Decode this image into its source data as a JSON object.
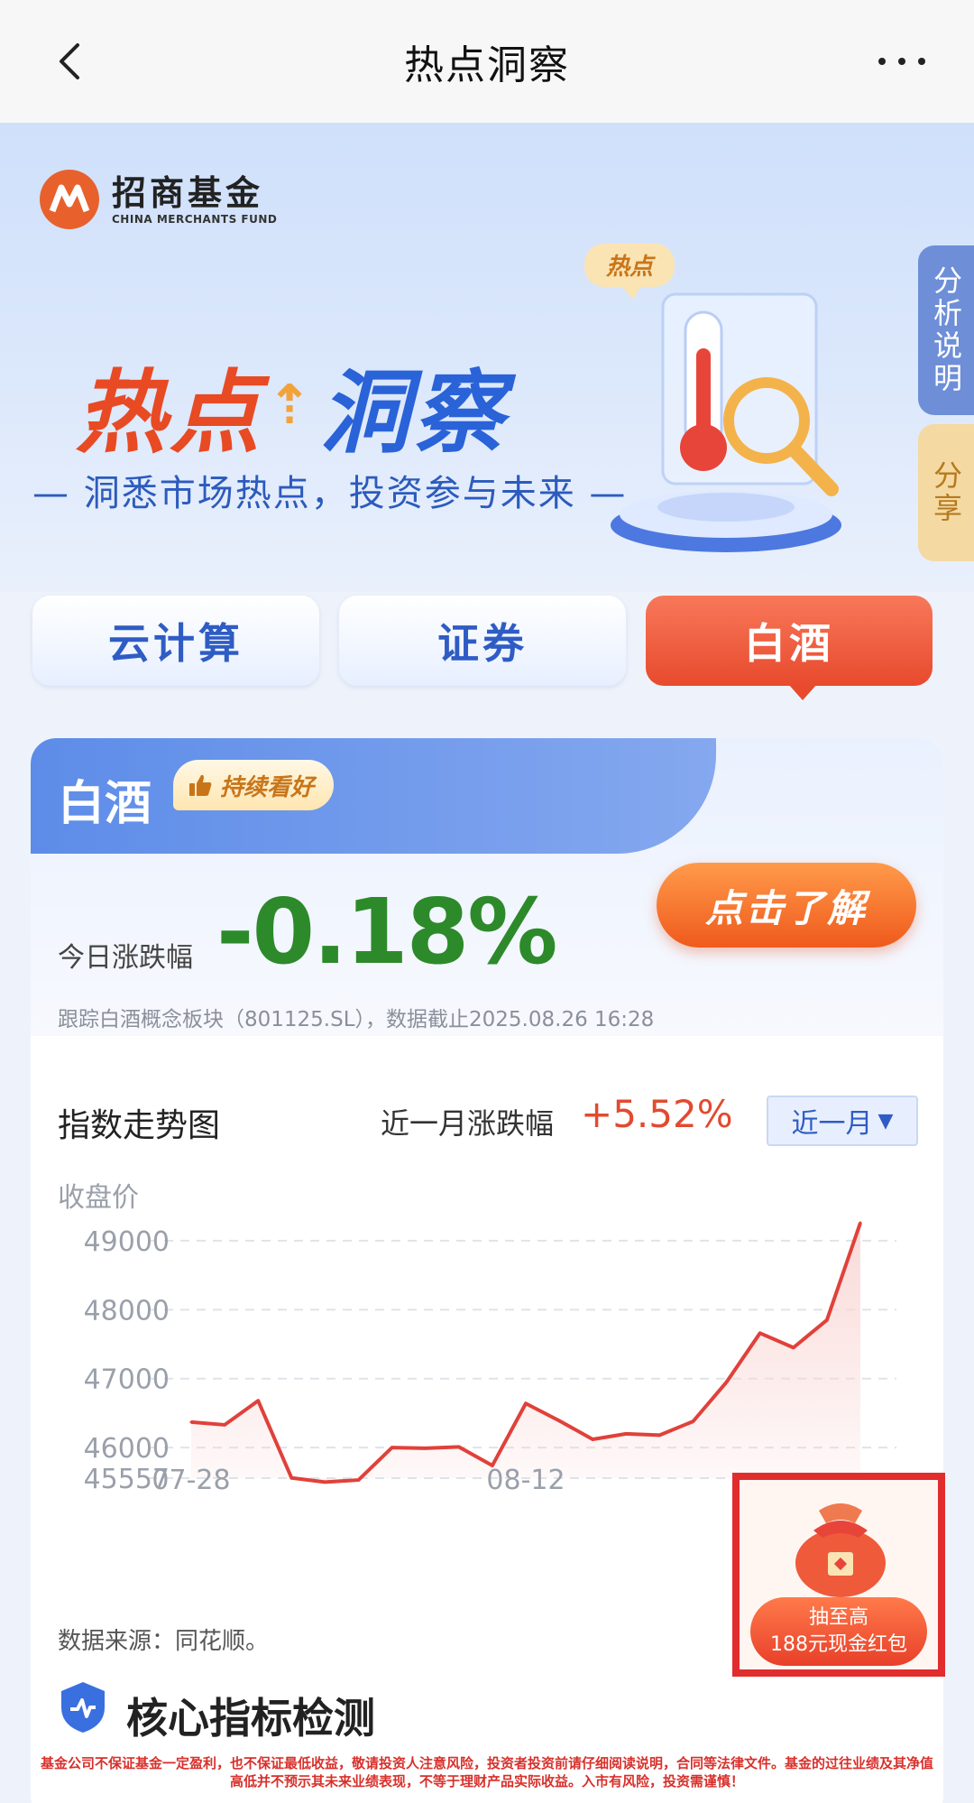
{
  "nav": {
    "title": "热点洞察"
  },
  "hero": {
    "logo_cn": "招商基金",
    "logo_en": "CHINA MERCHANTS FUND",
    "title_part1": "热点",
    "title_part2": "洞察",
    "subtitle": "— 洞悉市场热点，投资参与未来 —",
    "hot_tag": "热点",
    "side_analysis": "分析说明",
    "side_share": "分享"
  },
  "tabs": [
    {
      "label": "云计算",
      "active": false
    },
    {
      "label": "证券",
      "active": false
    },
    {
      "label": "白酒",
      "active": true
    }
  ],
  "card": {
    "name": "白酒",
    "badge": "持续看好",
    "today_label": "今日涨跌幅",
    "today_value": "-0.18%",
    "learn_button": "点击了解",
    "track_note": "跟踪白酒概念板块（801125.SL），数据截止2025.08.26 16:28"
  },
  "chart_section": {
    "title": "指数走势图",
    "month_label": "近一月涨跌幅",
    "month_value": "+5.52%",
    "period": "近一月",
    "y_name": "收盘价",
    "source": "数据来源：同花顺。"
  },
  "chart_data": {
    "type": "area",
    "ylabel": "收盘价",
    "ylim": [
      45557,
      49300
    ],
    "y_ticks": [
      49000,
      48000,
      47000,
      46000,
      45557
    ],
    "x_ticks": [
      "07-28",
      "08-12"
    ],
    "points": [
      46370,
      46330,
      46680,
      45560,
      45500,
      45530,
      46000,
      45990,
      46010,
      45740,
      46640,
      46390,
      46120,
      46200,
      46180,
      46380,
      46950,
      47660,
      47450,
      47850,
      49260
    ],
    "x_tick_index": [
      0,
      10
    ],
    "line_color": "#e0413a",
    "fill_color": "#f9d8d6"
  },
  "core": {
    "title": "核心指标检测"
  },
  "promo": {
    "line1": "抽至高",
    "line2": "188元现金红包"
  },
  "disclaimer": "基金公司不保证基金一定盈利，也不保证最低收益，敬请投资人注意风险，投资者投资前请仔细阅读说明，合同等法律文件。基金的过往业绩及其净值高低并不预示其未来业绩表现，不等于理财产品实际收益。入市有风险，投资需谨慎！"
}
